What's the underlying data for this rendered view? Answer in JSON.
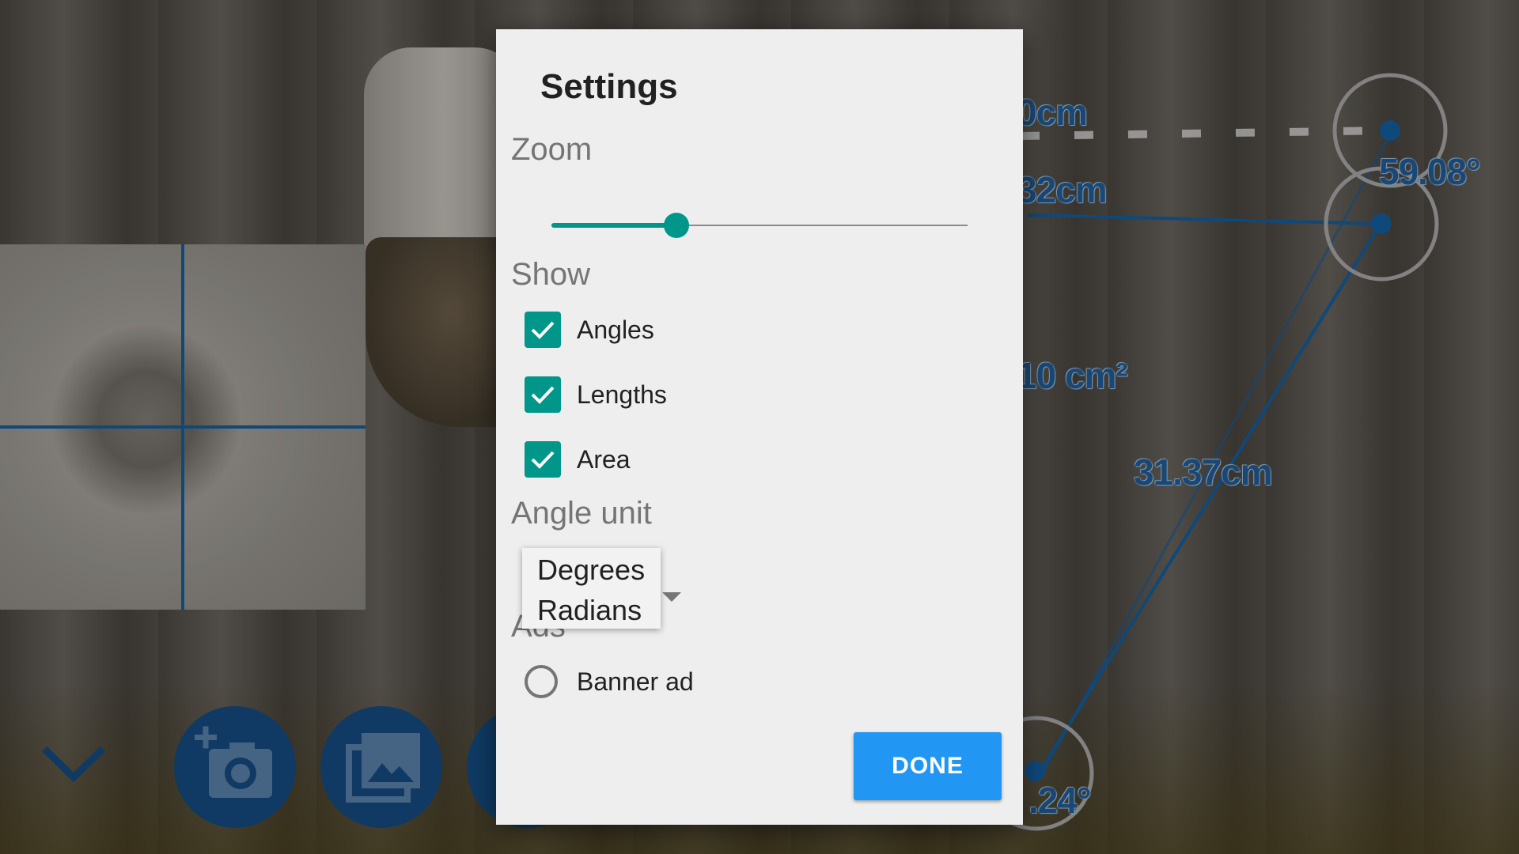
{
  "background": {
    "measurements": {
      "length_top": "0cm",
      "length_second": "32cm",
      "area": "10 cm²",
      "length_diagonal": "31.37cm",
      "angle_top": "59.08°",
      "angle_bottom": ".24°"
    },
    "toolbar": {
      "collapse_icon": "chevron-down-icon",
      "camera_icon": "add-photo-icon",
      "gallery_icon": "photo-library-icon"
    },
    "colors": {
      "measure_line": "#114f86",
      "fab": "#123f6c"
    }
  },
  "dialog": {
    "title": "Settings",
    "zoom": {
      "label": "Zoom",
      "level": 0.3
    },
    "show": {
      "label": "Show",
      "options": [
        {
          "label": "Angles",
          "checked": true
        },
        {
          "label": "Lengths",
          "checked": true
        },
        {
          "label": "Area",
          "checked": true
        }
      ]
    },
    "angle_unit": {
      "label": "Angle unit",
      "options": [
        "Degrees",
        "Radians"
      ]
    },
    "ads": {
      "label": "Ads",
      "banner_label": "Banner ad",
      "banner_selected": false
    },
    "done_label": "DONE",
    "colors": {
      "accent": "#00968a",
      "button": "#2196f3"
    }
  }
}
